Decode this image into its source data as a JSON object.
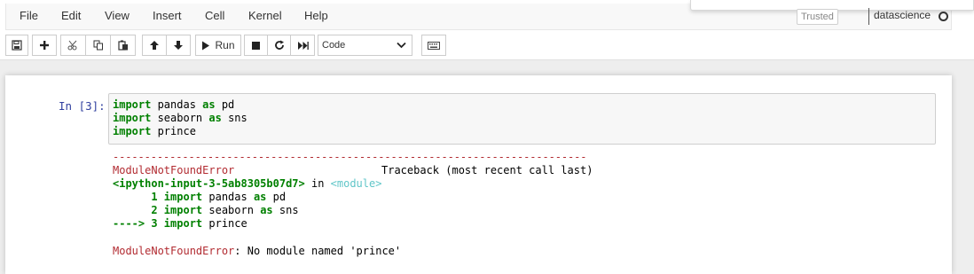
{
  "menu": [
    "File",
    "Edit",
    "View",
    "Insert",
    "Cell",
    "Kernel",
    "Help"
  ],
  "status": {
    "trusted": "Trusted",
    "kernel": "datascience"
  },
  "toolbar": {
    "run_label": "Run",
    "cell_type": "Code"
  },
  "cell": {
    "prompt": "In [3]:",
    "code": [
      {
        "kw": "import",
        "mid": " pandas ",
        "kw2": "as",
        "rest": " pd"
      },
      {
        "kw": "import",
        "mid": " seaborn ",
        "kw2": "as",
        "rest": " sns"
      },
      {
        "kw": "import",
        "mid": " prince",
        "kw2": "",
        "rest": ""
      }
    ]
  },
  "output": {
    "dashes": "---------------------------------------------------------------------------",
    "error_name": "ModuleNotFoundError",
    "traceback_header": "Traceback (most recent call last)",
    "input_ref": "<ipython-input-3-5ab8305b07d7>",
    "in_word": " in ",
    "module_ref": "<module>",
    "tb_lines": [
      {
        "prefix": "      1 ",
        "kw": "import",
        "mid": " pandas ",
        "kw2": "as",
        "rest": " pd"
      },
      {
        "prefix": "      2 ",
        "kw": "import",
        "mid": " seaborn ",
        "kw2": "as",
        "rest": " sns"
      },
      {
        "prefix": "----> 3 ",
        "kw": "import",
        "mid": " prince",
        "kw2": "",
        "rest": ""
      }
    ],
    "error_message": ": No module named 'prince'"
  }
}
